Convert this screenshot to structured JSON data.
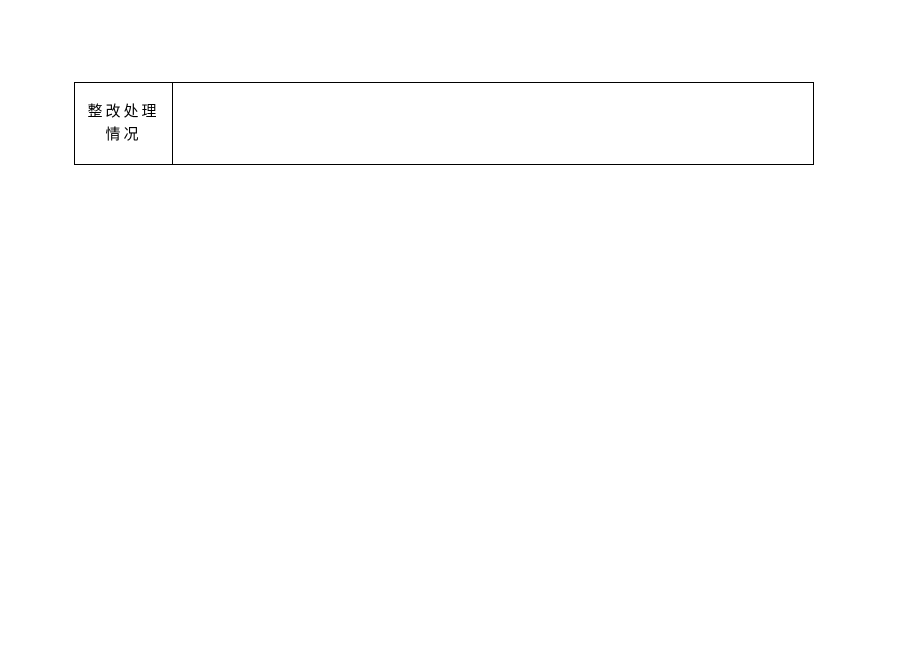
{
  "table": {
    "row": {
      "label_line1": "整改处理",
      "label_line2": "情况",
      "content": ""
    }
  }
}
